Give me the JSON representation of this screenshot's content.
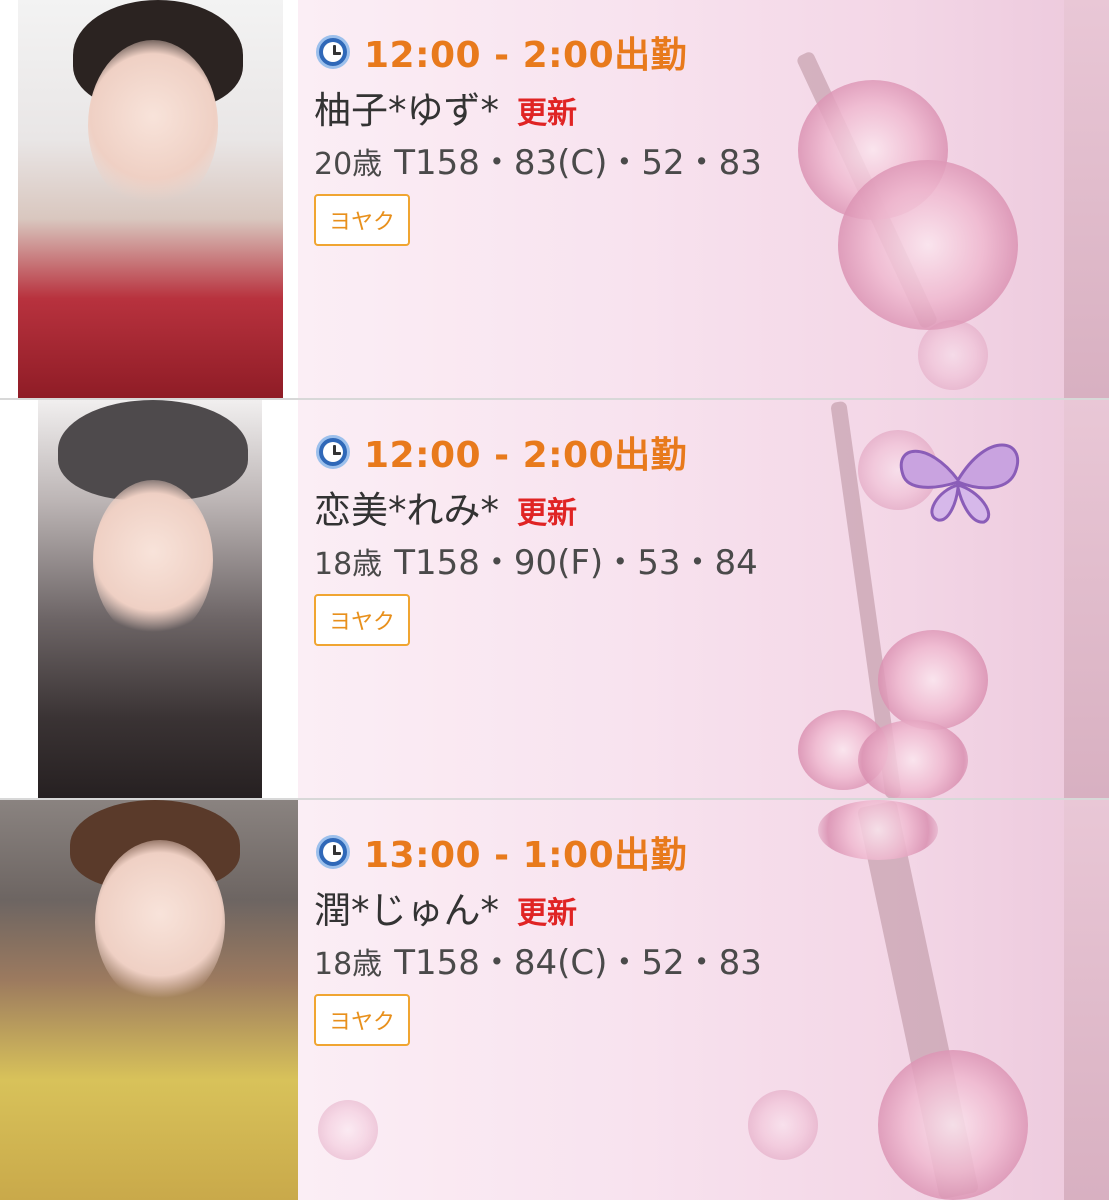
{
  "entries": [
    {
      "time": "12:00 - 2:00出勤",
      "name": "柚子*ゆず*",
      "badge": "更新",
      "age": "20歳",
      "measurements": "T158・83(C)・52・83",
      "reserve_label": "ヨヤク"
    },
    {
      "time": "12:00 - 2:00出勤",
      "name": "恋美*れみ*",
      "badge": "更新",
      "age": "18歳",
      "measurements": "T158・90(F)・53・84",
      "reserve_label": "ヨヤク"
    },
    {
      "time": "13:00 - 1:00出勤",
      "name": "潤*じゅん*",
      "badge": "更新",
      "age": "18歳",
      "measurements": "T158・84(C)・52・83",
      "reserve_label": "ヨヤク"
    }
  ],
  "colors": {
    "time": "#e87a1c",
    "badge": "#e02424",
    "button_border": "#f0a531",
    "background": "#f8e3ef"
  },
  "icons": {
    "time": "clock-icon"
  }
}
